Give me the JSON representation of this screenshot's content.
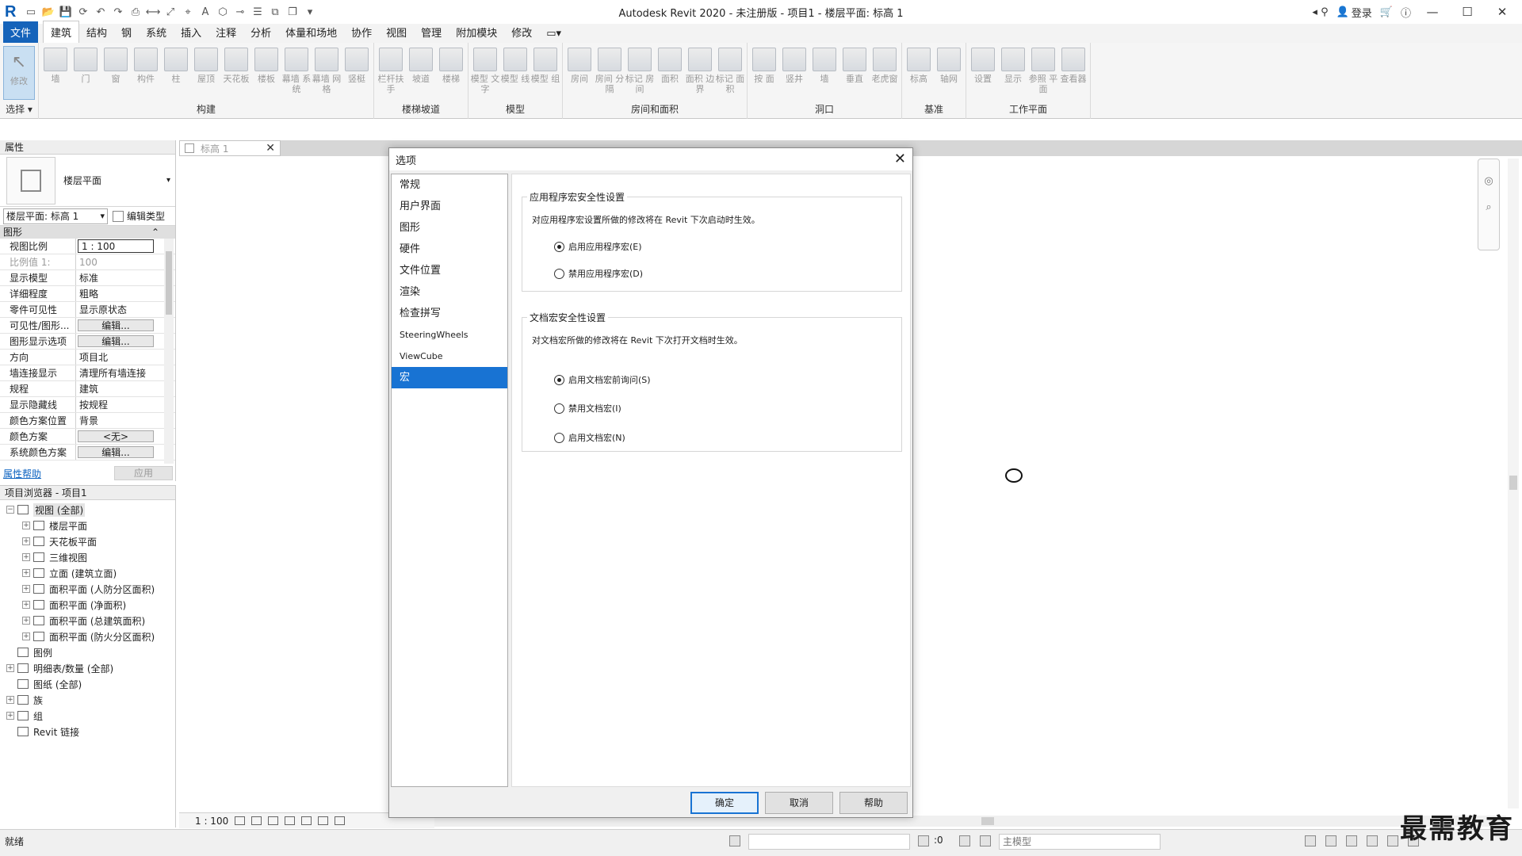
{
  "title_bar": {
    "title": "Autodesk Revit 2020 - 未注册版 - 项目1 - 楼层平面: 标高 1",
    "login_label": "登录"
  },
  "menu_tabs": [
    "文件",
    "建筑",
    "结构",
    "钢",
    "系统",
    "插入",
    "注释",
    "分析",
    "体量和场地",
    "协作",
    "视图",
    "管理",
    "附加模块",
    "修改"
  ],
  "ribbon": {
    "select_label": "选择",
    "modify_label": "修改",
    "groups": [
      {
        "label": "构建",
        "tools": [
          "墙",
          "门",
          "窗",
          "构件",
          "柱",
          "屋顶",
          "天花板",
          "楼板",
          "幕墙 系统",
          "幕墙 网格",
          "竖梃"
        ]
      },
      {
        "label": "楼梯坡道",
        "tools": [
          "栏杆扶手",
          "坡道",
          "楼梯"
        ]
      },
      {
        "label": "模型",
        "tools": [
          "模型 文字",
          "模型 线",
          "模型 组"
        ]
      },
      {
        "label": "房间和面积",
        "tools": [
          "房间",
          "房间 分隔",
          "标记 房间",
          "面积",
          "面积 边界",
          "标记 面积"
        ]
      },
      {
        "label": "洞口",
        "tools": [
          "按 面",
          "竖井",
          "墙",
          "垂直",
          "老虎窗"
        ]
      },
      {
        "label": "基准",
        "tools": [
          "标高",
          "轴网"
        ]
      },
      {
        "label": "工作平面",
        "tools": [
          "设置",
          "显示",
          "参照 平面",
          "查看器"
        ]
      }
    ]
  },
  "properties": {
    "header": "属性",
    "type_name": "楼层平面",
    "instance_selector": "楼层平面: 标高 1",
    "edit_type": "编辑类型",
    "category": "图形",
    "rows": [
      {
        "key": "视图比例",
        "value": "1 : 100",
        "kind": "input"
      },
      {
        "key": "比例值 1:",
        "value": "100",
        "kind": "dim"
      },
      {
        "key": "显示模型",
        "value": "标准",
        "kind": "text"
      },
      {
        "key": "详细程度",
        "value": "粗略",
        "kind": "text"
      },
      {
        "key": "零件可见性",
        "value": "显示原状态",
        "kind": "text"
      },
      {
        "key": "可见性/图形...",
        "value": "编辑...",
        "kind": "button"
      },
      {
        "key": "图形显示选项",
        "value": "编辑...",
        "kind": "button"
      },
      {
        "key": "方向",
        "value": "项目北",
        "kind": "text"
      },
      {
        "key": "墙连接显示",
        "value": "清理所有墙连接",
        "kind": "text"
      },
      {
        "key": "规程",
        "value": "建筑",
        "kind": "text"
      },
      {
        "key": "显示隐藏线",
        "value": "按规程",
        "kind": "text"
      },
      {
        "key": "颜色方案位置",
        "value": "背景",
        "kind": "text"
      },
      {
        "key": "颜色方案",
        "value": "<无>",
        "kind": "button"
      },
      {
        "key": "系统颜色方案",
        "value": "编辑...",
        "kind": "button"
      }
    ],
    "help_link": "属性帮助",
    "apply_button": "应用"
  },
  "project_browser": {
    "header": "项目浏览器 - 项目1",
    "nodes": [
      {
        "label": "视图 (全部)",
        "level": 0,
        "expander": "−"
      },
      {
        "label": "楼层平面",
        "level": 1,
        "expander": "+"
      },
      {
        "label": "天花板平面",
        "level": 1,
        "expander": "+"
      },
      {
        "label": "三维视图",
        "level": 1,
        "expander": "+"
      },
      {
        "label": "立面 (建筑立面)",
        "level": 1,
        "expander": "+"
      },
      {
        "label": "面积平面 (人防分区面积)",
        "level": 1,
        "expander": "+"
      },
      {
        "label": "面积平面 (净面积)",
        "level": 1,
        "expander": "+"
      },
      {
        "label": "面积平面 (总建筑面积)",
        "level": 1,
        "expander": "+"
      },
      {
        "label": "面积平面 (防火分区面积)",
        "level": 1,
        "expander": "+"
      },
      {
        "label": "图例",
        "level": 0,
        "expander": ""
      },
      {
        "label": "明细表/数量 (全部)",
        "level": 0,
        "expander": "+"
      },
      {
        "label": "图纸 (全部)",
        "level": 0,
        "expander": ""
      },
      {
        "label": "族",
        "level": 0,
        "expander": "+"
      },
      {
        "label": "组",
        "level": 0,
        "expander": "+"
      },
      {
        "label": "Revit 链接",
        "level": 0,
        "expander": ""
      }
    ]
  },
  "view": {
    "tab_label": "标高 1",
    "scale": "1 : 100"
  },
  "options_dialog": {
    "title": "选项",
    "nav_items": [
      {
        "label": "常规",
        "small": false
      },
      {
        "label": "用户界面",
        "small": false
      },
      {
        "label": "图形",
        "small": false
      },
      {
        "label": "硬件",
        "small": false
      },
      {
        "label": "文件位置",
        "small": false
      },
      {
        "label": "渲染",
        "small": false
      },
      {
        "label": "检查拼写",
        "small": false
      },
      {
        "label": "SteeringWheels",
        "small": true
      },
      {
        "label": "ViewCube",
        "small": true
      },
      {
        "label": "宏",
        "small": false
      }
    ],
    "active_nav": "宏",
    "app_macro": {
      "legend": "应用程序宏安全性设置",
      "description": "对应用程序宏设置所做的修改将在 Revit 下次启动时生效。",
      "options": [
        {
          "label": "启用应用程序宏(E)",
          "checked": true
        },
        {
          "label": "禁用应用程序宏(D)",
          "checked": false
        }
      ]
    },
    "doc_macro": {
      "legend": "文档宏安全性设置",
      "description": "对文档宏所做的修改将在 Revit 下次打开文档时生效。",
      "options": [
        {
          "label": "启用文档宏前询问(S)",
          "checked": true
        },
        {
          "label": "禁用文档宏(I)",
          "checked": false
        },
        {
          "label": "启用文档宏(N)",
          "checked": false
        }
      ]
    },
    "buttons": {
      "ok": "确定",
      "cancel": "取消",
      "help": "帮助"
    }
  },
  "status_bar": {
    "status": "就绪",
    "workset_count": ":0",
    "model_selector": "主模型"
  },
  "watermark": "最需教育",
  "colors": {
    "accent": "#1873d3",
    "file_tab": "#1563ba"
  }
}
